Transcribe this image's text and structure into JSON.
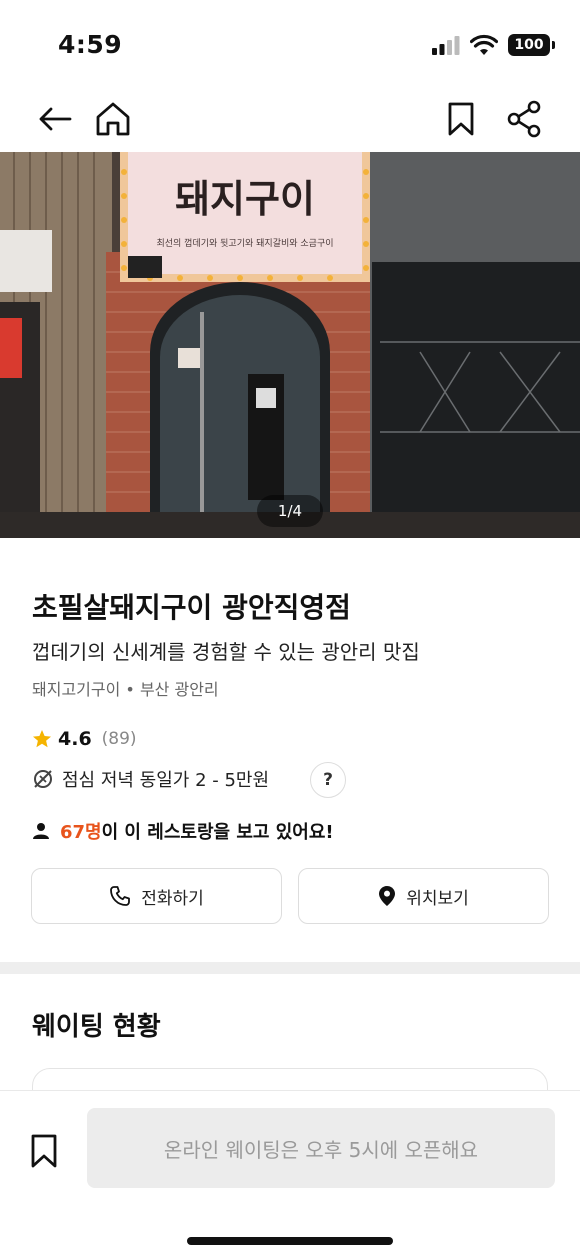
{
  "status_bar": {
    "time": "4:59",
    "battery": "100"
  },
  "hero": {
    "page_indicator": "1/4",
    "sign_text": "돼지구이",
    "sign_subtext": "최선의 껍데기와 뒷고기와 돼지갈비와 소금구이"
  },
  "restaurant": {
    "name": "초필살돼지구이 광안직영점",
    "tagline": "껍데기의 신세계를 경험할 수 있는 광안리 맛집",
    "category": "돼지고기구이",
    "location": "부산 광안리",
    "rating": "4.6",
    "review_count": "(89)",
    "price_info": "점심 저녁 동일가 2 - 5만원",
    "help_label": "?",
    "viewers_count": "67명",
    "viewers_suffix": "이 이 레스토랑을 보고 있어요!"
  },
  "actions": {
    "call_label": "전화하기",
    "location_label": "위치보기"
  },
  "waiting": {
    "section_title": "웨이팅 현황"
  },
  "bottom_bar": {
    "cta_label": "온라인 웨이팅은 오후 5시에 오픈해요"
  },
  "colors": {
    "accent": "#e8541c",
    "star": "#f5b400",
    "cta_bg": "#ececec"
  }
}
